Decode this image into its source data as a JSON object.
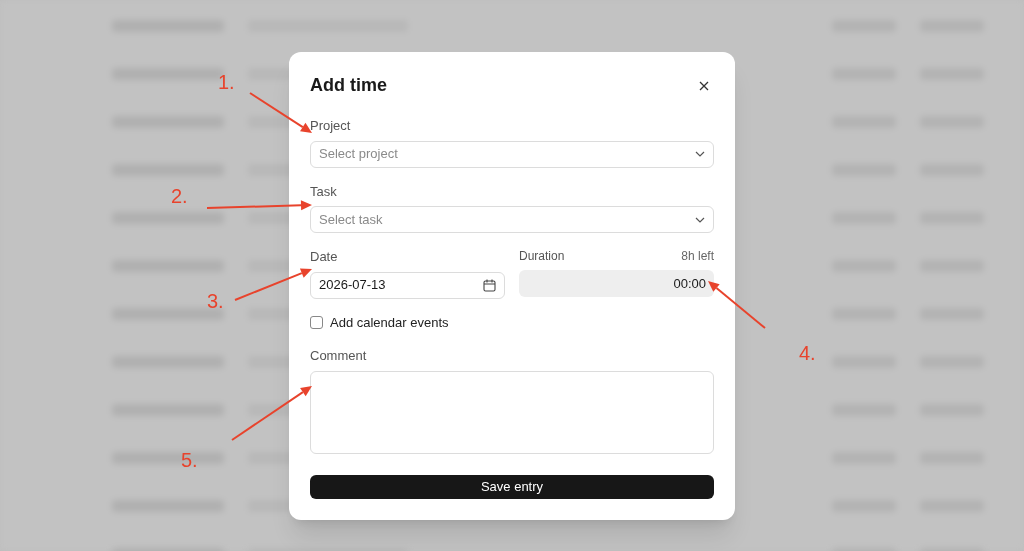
{
  "dialog": {
    "title": "Add time",
    "project": {
      "label": "Project",
      "placeholder": "Select project"
    },
    "task": {
      "label": "Task",
      "placeholder": "Select task"
    },
    "date": {
      "label": "Date",
      "value": "2026-07-13"
    },
    "duration": {
      "label": "Duration",
      "hint": "8h left",
      "value": "00:00",
      "disabled": true
    },
    "calendar_events": {
      "label": "Add calendar events",
      "checked": false
    },
    "comment": {
      "label": "Comment"
    },
    "save_button": "Save entry"
  },
  "annotations": [
    {
      "label": "1."
    },
    {
      "label": "2."
    },
    {
      "label": "3."
    },
    {
      "label": "4."
    },
    {
      "label": "5."
    }
  ]
}
